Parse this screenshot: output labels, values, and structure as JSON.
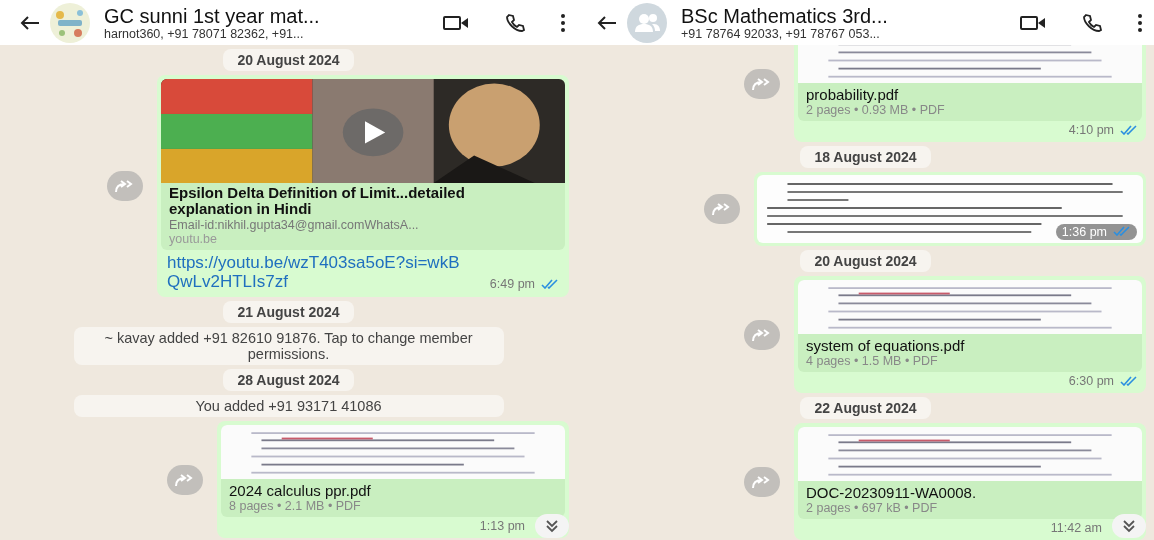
{
  "chats": [
    {
      "title": "GC sunni 1st year mat...",
      "subtitle": "harnot360, +91 78071 82362, +91...",
      "avatar_photo": true,
      "messages": [
        {
          "kind": "date",
          "text": "20 August 2024"
        },
        {
          "kind": "link",
          "forward": true,
          "title": "Epsilon Delta Definition of Limit...detailed explanation in Hindi",
          "description": "Email-id:nikhil.gupta34@gmail.comWhatsA...",
          "domain": "youtu.be",
          "url": "https://youtu.be/wzT403sa5oE?si=wkBQwLv2HTLIs7zf",
          "time": "6:49 pm",
          "read": true
        },
        {
          "kind": "date",
          "text": "21 August 2024"
        },
        {
          "kind": "system",
          "text": "~ kavay added +91 82610 91876. Tap to change member permissions."
        },
        {
          "kind": "date",
          "text": "28 August 2024"
        },
        {
          "kind": "system",
          "text": "You added +91 93171 41086"
        },
        {
          "kind": "document",
          "forward": true,
          "name": "2024 calculus ppr.pdf",
          "meta": "8 pages • 2.1 MB • PDF",
          "time": "1:13 pm"
        }
      ]
    },
    {
      "title": "BSc Mathematics 3rd...",
      "subtitle": "+91 78764 92033, +91 78767 053...",
      "avatar_photo": false,
      "messages": [
        {
          "kind": "document",
          "forward": true,
          "name": "probability.pdf",
          "meta": "2 pages • 0.93 MB • PDF",
          "time": "4:10 pm",
          "read": true
        },
        {
          "kind": "date",
          "text": "18 August 2024"
        },
        {
          "forward": true,
          "time": "1:36 pm",
          "read": true
        },
        {
          "kind": "date",
          "text": "20 August 2024"
        },
        {
          "kind": "document",
          "forward": true,
          "name": "system of equations.pdf",
          "meta": "4 pages • 1.5 MB • PDF",
          "time": "6:30 pm",
          "read": true
        },
        {
          "kind": "date",
          "text": "22 August 2024"
        },
        {
          "kind": "document",
          "forward": true,
          "name": "DOC-20230911-WA0008.",
          "meta": "2 pages • 697 kB • PDF",
          "time": "11:42 am"
        }
      ]
    }
  ]
}
